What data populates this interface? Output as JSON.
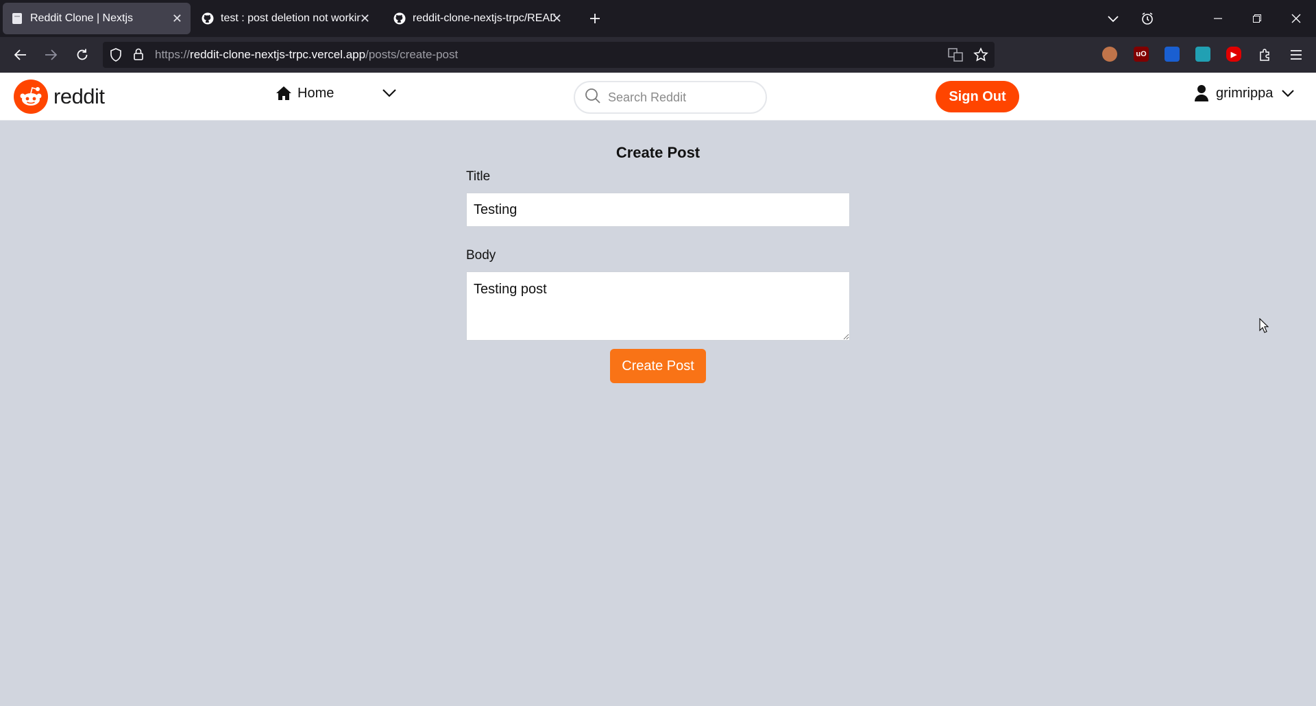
{
  "browser": {
    "tabs": [
      {
        "label": "Reddit Clone | Nextjs",
        "favicon": "page-icon",
        "active": true
      },
      {
        "label": "test : post deletion not working",
        "favicon": "github-icon",
        "active": false
      },
      {
        "label": "reddit-clone-nextjs-trpc/READM",
        "favicon": "github-icon",
        "active": false
      }
    ],
    "url": {
      "protocol": "https://",
      "host": "reddit-clone-nextjs-trpc.vercel.app",
      "path": "/posts/create-post"
    }
  },
  "header": {
    "logo_text": "reddit",
    "home_label": "Home",
    "search_placeholder": "Search Reddit",
    "signout_label": "Sign Out",
    "username": "grimrippa"
  },
  "form": {
    "heading": "Create Post",
    "title_label": "Title",
    "title_value": "Testing",
    "body_label": "Body",
    "body_value": "Testing post",
    "submit_label": "Create Post"
  },
  "colors": {
    "brand": "#ff4500",
    "submit": "#f97316",
    "page_bg": "#d1d5de"
  }
}
